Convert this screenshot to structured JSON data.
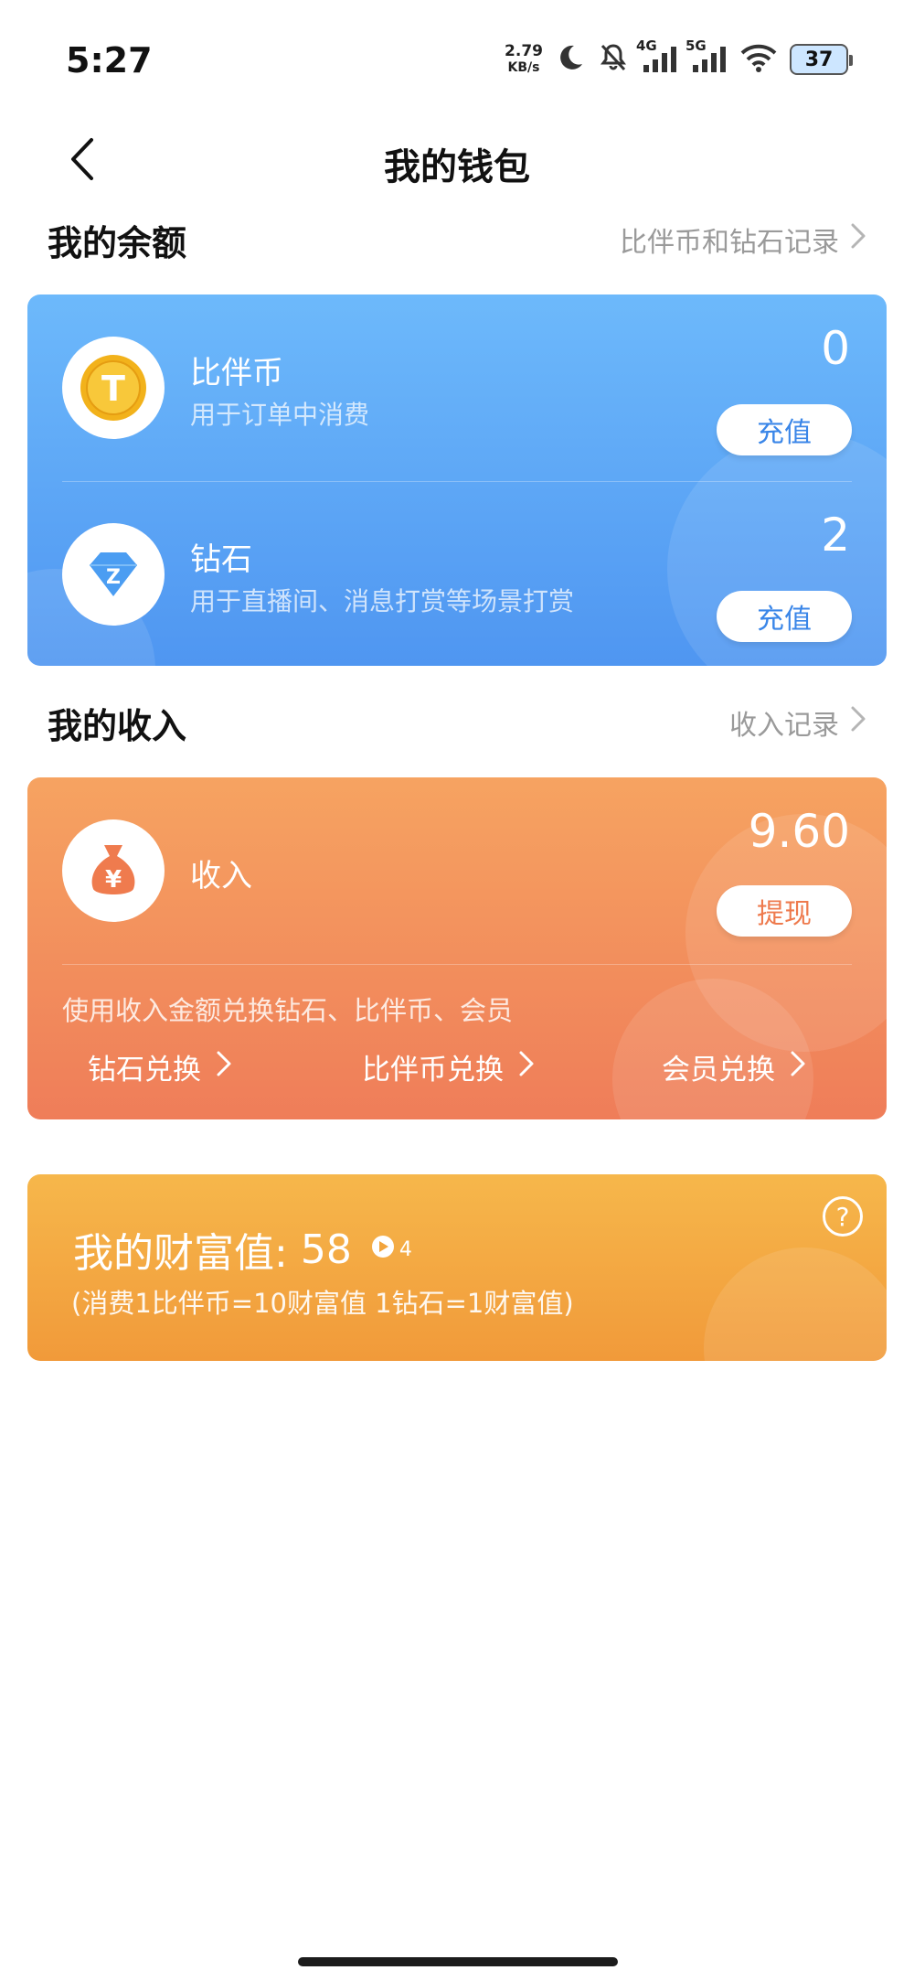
{
  "status_bar": {
    "time": "5:27",
    "net_speed_value": "2.79",
    "net_speed_unit": "KB/s",
    "signal1_label": "4G",
    "signal2_label": "5G",
    "battery": "37"
  },
  "header": {
    "title": "我的钱包"
  },
  "balance_section": {
    "title": "我的余额",
    "link": "比伴币和钻石记录",
    "coin": {
      "icon_letter": "T",
      "title": "比伴币",
      "desc": "用于订单中消费",
      "value": "0",
      "button": "充值"
    },
    "diamond": {
      "icon_letter": "Z",
      "title": "钻石",
      "desc": "用于直播间、消息打赏等场景打赏",
      "value": "2",
      "button": "充值"
    }
  },
  "income_section": {
    "title": "我的收入",
    "link": "收入记录",
    "income": {
      "icon_symbol": "¥",
      "title": "收入",
      "value": "9.60",
      "button": "提现"
    },
    "exchange_note": "使用收入金额兑换钻石、比伴币、会员",
    "exchanges": [
      "钻石兑换",
      "比伴币兑换",
      "会员兑换"
    ]
  },
  "wealth": {
    "label": "我的财富值:",
    "value": "58",
    "badge": "4",
    "note": "(消费1比伴币=10财富值 1钻石=1财富值)",
    "help": "?"
  },
  "colors": {
    "blue_card_top": "#6db9fb",
    "blue_card_bottom": "#4f96f1",
    "orange_card_top": "#f6a361",
    "orange_card_bottom": "#ef7d59",
    "yellow_card_top": "#f6b74b",
    "yellow_card_bottom": "#f19a3a",
    "coin_gold": "#f2b21b",
    "diamond_blue": "#4b9df2",
    "moneybag_orange": "#ef7b4e"
  }
}
